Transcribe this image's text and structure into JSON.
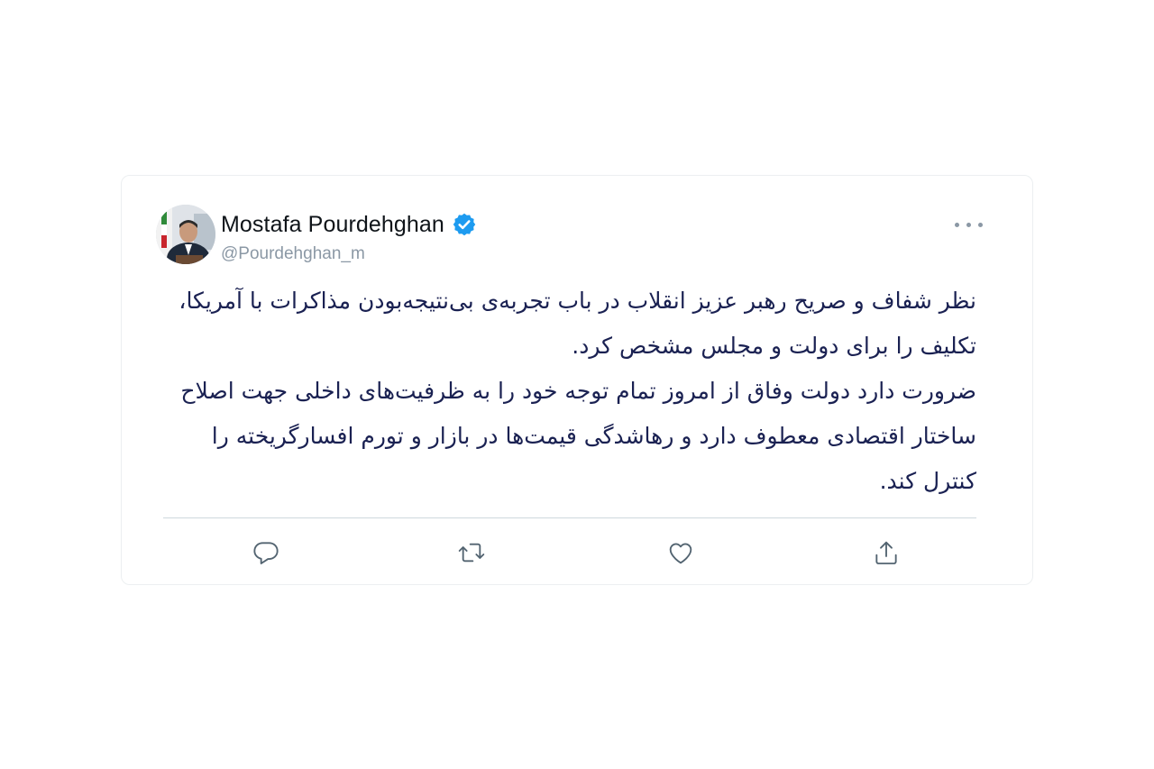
{
  "tweet": {
    "author": {
      "display_name": "Mostafa Pourdehghan",
      "handle": "@Pourdehghan_m",
      "verified": true,
      "avatar_icon": "profile-photo"
    },
    "text_lines": [
      "نظر شفاف و صریح رهبر عزیز انقلاب در باب تجربه‌ی بی‌نتیجه‌بودن مذاکرات با آمریکا، تکلیف را برای دولت و مجلس مشخص کرد.",
      "ضرورت دارد دولت وفاق از امروز تمام توجه خود را به ظرفیت‌های داخلی جهت اصلاح ساختار اقتصادی معطوف دارد و رهاشدگی قیمت‌ها در بازار و تورم افسارگریخته را کنترل کند."
    ],
    "actions": [
      {
        "name": "reply",
        "icon": "comment-icon"
      },
      {
        "name": "retweet",
        "icon": "retweet-icon"
      },
      {
        "name": "like",
        "icon": "heart-icon"
      },
      {
        "name": "share",
        "icon": "share-icon"
      }
    ]
  },
  "colors": {
    "text": "#1a2152",
    "name": "#0f1419",
    "muted": "#8b98a5",
    "verified": "#1d9bf0",
    "divider": "#cfd9de"
  }
}
